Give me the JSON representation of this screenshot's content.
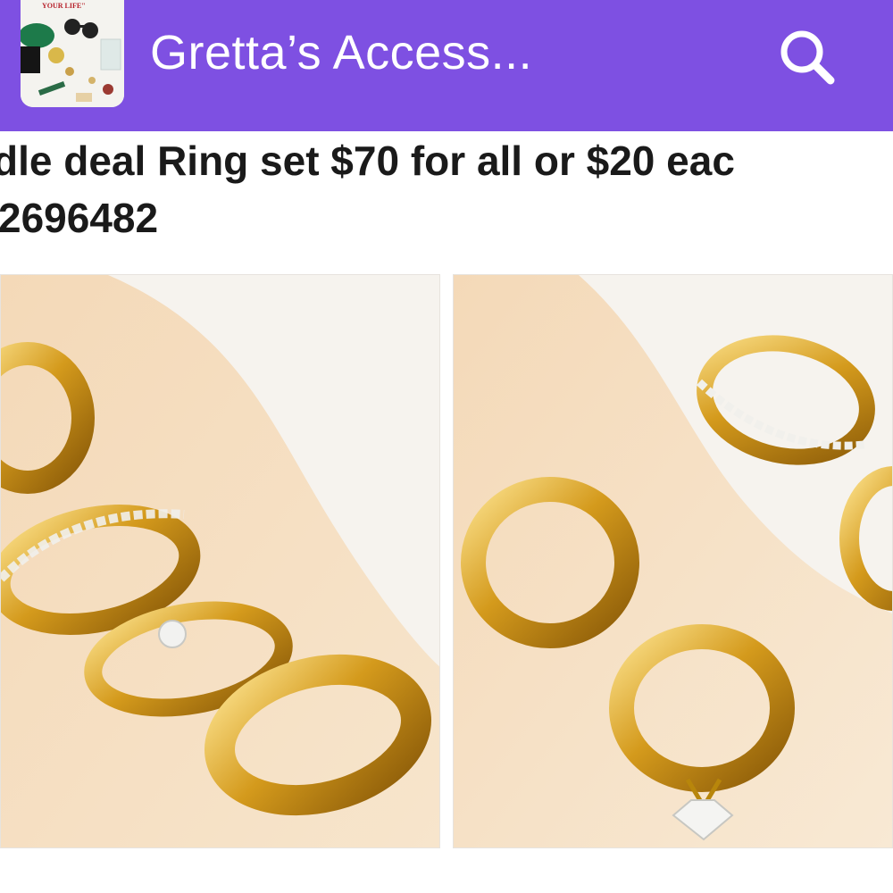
{
  "header": {
    "app_name": "Gretta’s Access...",
    "icon_text": "YOUR LIFE\"",
    "search_icon": "search-icon",
    "background_color": "#7e50e2"
  },
  "listing": {
    "title_line1": "dle deal Ring set $70 for all or $20 eac",
    "title_line2": "2696482"
  },
  "photos": [
    {
      "name": "product-photo-1",
      "icon": "gold-rings-photo"
    },
    {
      "name": "product-photo-2",
      "icon": "gold-rings-photo"
    }
  ]
}
